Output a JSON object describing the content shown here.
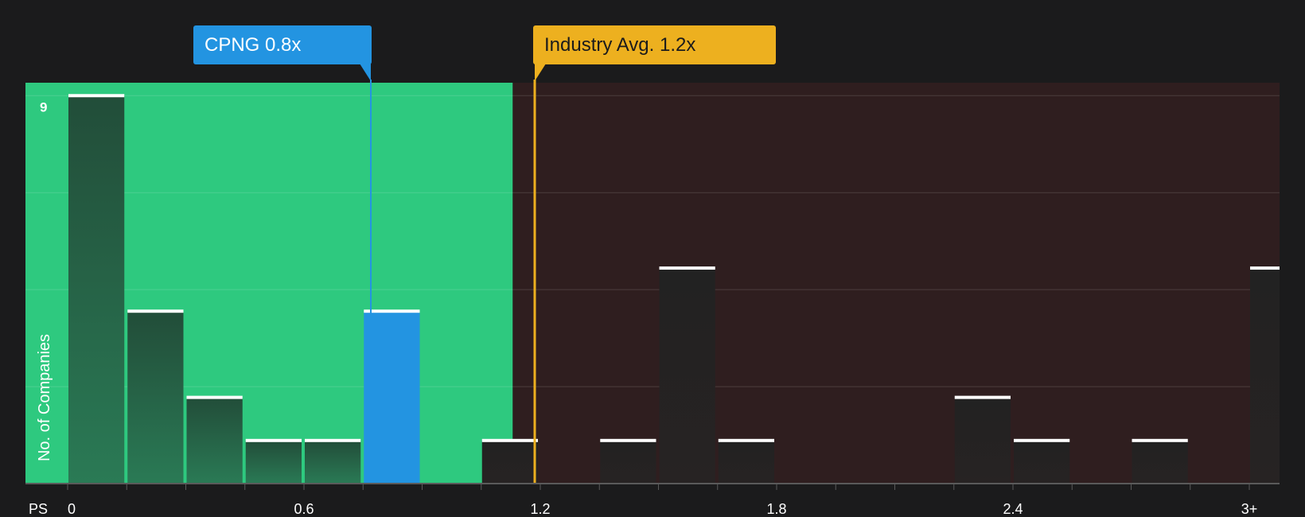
{
  "chart_data": {
    "type": "bar",
    "xlabel": "PS",
    "ylabel": "No. of Companies",
    "bin_width": 0.15,
    "bins": [
      {
        "x0": 0.0,
        "value": 9
      },
      {
        "x0": 0.15,
        "value": 4
      },
      {
        "x0": 0.3,
        "value": 2
      },
      {
        "x0": 0.45,
        "value": 1
      },
      {
        "x0": 0.6,
        "value": 1
      },
      {
        "x0": 0.75,
        "value": 4,
        "highlight": true
      },
      {
        "x0": 0.9,
        "value": 0
      },
      {
        "x0": 1.05,
        "value": 1
      },
      {
        "x0": 1.2,
        "value": 0
      },
      {
        "x0": 1.35,
        "value": 1
      },
      {
        "x0": 1.5,
        "value": 5
      },
      {
        "x0": 1.65,
        "value": 1
      },
      {
        "x0": 2.25,
        "value": 2
      },
      {
        "x0": 2.4,
        "value": 1
      },
      {
        "x0": 2.7,
        "value": 1
      },
      {
        "x0": 3.0,
        "value": 5
      }
    ],
    "x_ticks": [
      {
        "value": 0,
        "label": "0"
      },
      {
        "value": 0.6,
        "label": "0.6"
      },
      {
        "value": 1.2,
        "label": "1.2"
      },
      {
        "value": 1.8,
        "label": "1.8"
      },
      {
        "value": 2.4,
        "label": "2.4"
      },
      {
        "value": 3.0,
        "label": "3+"
      }
    ],
    "y_tick_labels": [
      {
        "value": 9,
        "label": "9"
      }
    ],
    "ylim": [
      0,
      9.3
    ],
    "y_gridlines": [
      2.25,
      4.5,
      6.75,
      9
    ],
    "fair_range": [
      0,
      1.13
    ],
    "company": {
      "label": "CPNG 0.8x",
      "value": 0.8
    },
    "industry": {
      "label": "Industry Avg. 1.2x",
      "value": 1.2
    },
    "colors": {
      "background": "#1b1b1c",
      "undervalued_region": "#2ec97f",
      "overvalued_region": "#2f1e1f",
      "highlight_bar": "#2394e1",
      "company_marker": "#2394e1",
      "industry_marker": "#edb01f",
      "bar_cap": "#ffffff"
    }
  }
}
